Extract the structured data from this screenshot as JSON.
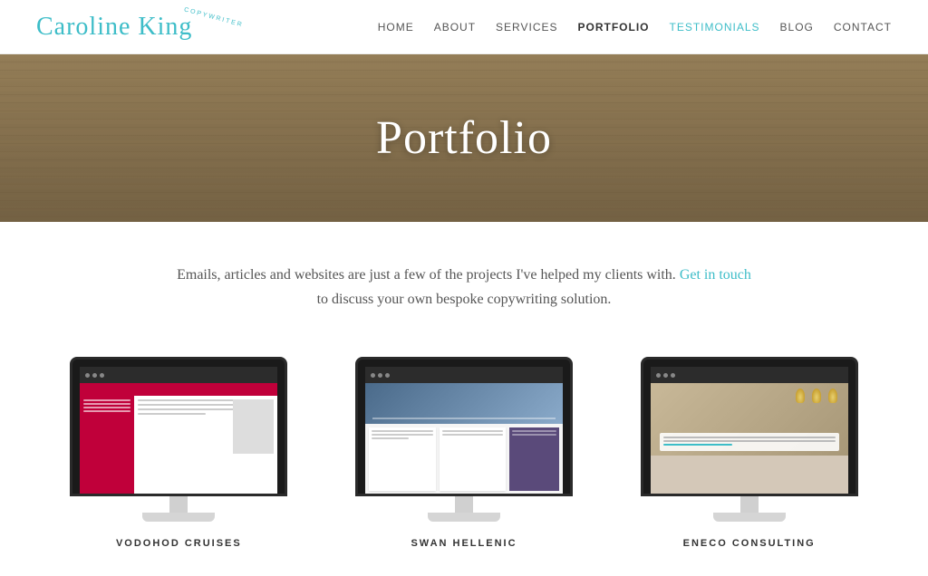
{
  "header": {
    "logo": "Caroline King",
    "logo_sub": "COPYWRITER",
    "nav": [
      {
        "label": "HOME",
        "id": "home",
        "active": false
      },
      {
        "label": "ABOUT",
        "id": "about",
        "active": false
      },
      {
        "label": "SERVICES",
        "id": "services",
        "active": false
      },
      {
        "label": "PORTFOLIO",
        "id": "portfolio",
        "active": true
      },
      {
        "label": "TESTIMONIALS",
        "id": "testimonials",
        "active": false,
        "highlight": true
      },
      {
        "label": "BLOG",
        "id": "blog",
        "active": false
      },
      {
        "label": "CONTACT",
        "id": "contact",
        "active": false
      }
    ]
  },
  "hero": {
    "title": "Portfolio"
  },
  "intro": {
    "text_before": "Emails, articles and websites are just a few of the projects I've helped my clients with.",
    "link": "Get in touch",
    "text_after": "to discuss your own bespoke copywriting solution."
  },
  "portfolio": {
    "items": [
      {
        "id": "vodohod",
        "label": "VODOHOD CRUISES"
      },
      {
        "id": "swan",
        "label": "SWAN HELLENIC"
      },
      {
        "id": "eneco",
        "label": "ENECO CONSULTING"
      }
    ]
  },
  "colors": {
    "teal": "#3dbdc8",
    "dark": "#333",
    "mid": "#555"
  }
}
